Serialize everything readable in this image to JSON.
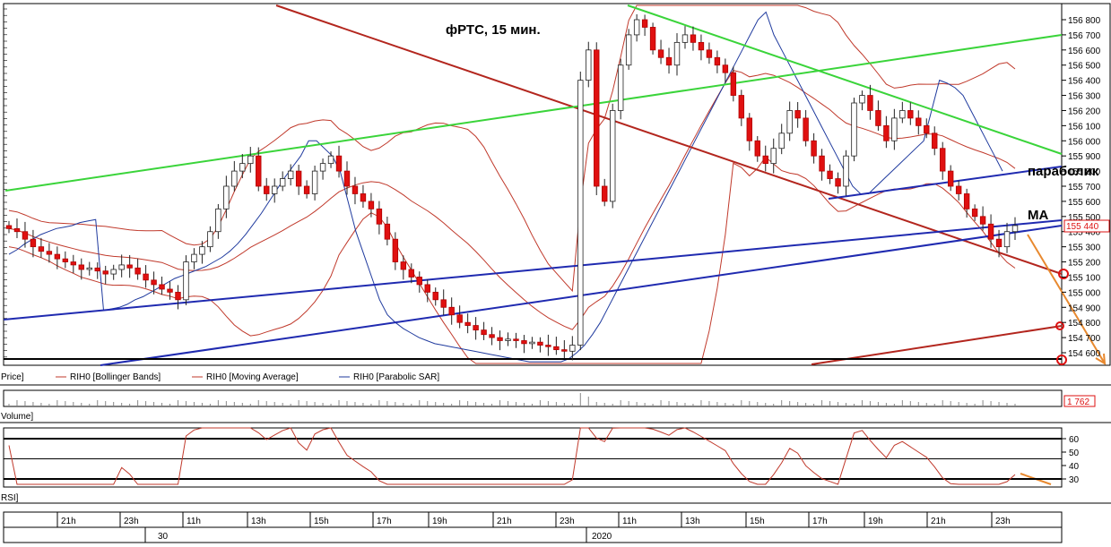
{
  "chart_data": {
    "type": "candlestick",
    "title": "фРТС,  15 мин.",
    "annotations": {
      "parabolic": "параболик",
      "ma": "MA"
    },
    "price_axis": {
      "ylim": [
        154500,
        156850
      ],
      "ticks": [
        "156 800",
        "156 700",
        "156 600",
        "156 500",
        "156 400",
        "156 300",
        "156 200",
        "156 100",
        "156 000",
        "155 900",
        "155 800",
        "155 700",
        "155 600",
        "155 500",
        "155 400",
        "155 300",
        "155 200",
        "155 100",
        "155 000",
        "154 900",
        "154 800",
        "154 700",
        "154 600"
      ],
      "tick_values": [
        156800,
        156700,
        156600,
        156500,
        156400,
        156300,
        156200,
        156100,
        156000,
        155900,
        155800,
        155700,
        155600,
        155500,
        155400,
        155300,
        155200,
        155100,
        155000,
        154900,
        154800,
        154700,
        154600
      ],
      "last_price_label": "155 440",
      "last_price": 155440
    },
    "legend": [
      "Price]",
      "RIH0 [Bollinger Bands]",
      "RIH0 [Moving Average]",
      "RIH0 [Parabolic SAR]"
    ],
    "volume": {
      "label": "Volume]",
      "last_value_label": "1 762"
    },
    "rsi": {
      "label": "RSI]",
      "ticks": [
        "60",
        "50",
        "40",
        "30"
      ],
      "tick_values": [
        60,
        50,
        40,
        30
      ],
      "levels": [
        60,
        45,
        30
      ]
    },
    "time_axis": {
      "hour_labels": [
        "21h",
        "23h",
        "11h",
        "13h",
        "15h",
        "17h",
        "19h",
        "21h",
        "23h",
        "11h",
        "13h",
        "15h",
        "17h",
        "19h",
        "21h",
        "23h"
      ],
      "day_labels": [
        "30",
        "2020"
      ]
    },
    "close_series": [
      155420,
      155400,
      155350,
      155300,
      155270,
      155250,
      155220,
      155200,
      155180,
      155150,
      155160,
      155140,
      155120,
      155150,
      155180,
      155160,
      155120,
      155080,
      155050,
      155020,
      155000,
      154950,
      155200,
      155250,
      155300,
      155400,
      155550,
      155700,
      155800,
      155850,
      155900,
      155700,
      155650,
      155700,
      155750,
      155800,
      155700,
      155650,
      155800,
      155850,
      155900,
      155800,
      155700,
      155650,
      155600,
      155550,
      155450,
      155350,
      155200,
      155150,
      155100,
      155050,
      155000,
      154950,
      154900,
      154850,
      154800,
      154780,
      154750,
      154720,
      154700,
      154680,
      154690,
      154680,
      154660,
      154670,
      154650,
      154640,
      154620,
      154610,
      154650,
      156400,
      156600,
      155700,
      155600,
      156200,
      156500,
      156700,
      156800,
      156750,
      156600,
      156550,
      156500,
      156650,
      156700,
      156650,
      156600,
      156550,
      156500,
      156450,
      156300,
      156150,
      156000,
      155900,
      155850,
      155950,
      156050,
      156200,
      156150,
      156000,
      155900,
      155800,
      155750,
      155700,
      155900,
      156250,
      156300,
      156200,
      156100,
      156000,
      156150,
      156200,
      156150,
      156100,
      156050,
      155950,
      155800,
      155700,
      155650,
      155550,
      155500,
      155450,
      155350,
      155300,
      155400,
      155440
    ],
    "parabolic_sar": [
      155250,
      155280,
      155320,
      155350,
      155380,
      155400,
      155420,
      155430,
      155440,
      155460,
      155470,
      155480,
      154880,
      154890,
      154900,
      154920,
      154950,
      154970,
      155000,
      155030,
      155060,
      155090,
      155110,
      155130,
      155150,
      155170,
      155200,
      155230,
      155270,
      155320,
      155380,
      155450,
      155520,
      155600,
      155680,
      155760,
      155830,
      155900,
      156000,
      156000,
      155950,
      155900,
      155800,
      155600,
      155400,
      155250,
      155100,
      154950,
      154850,
      154800,
      154760,
      154730,
      154700,
      154680,
      154660,
      154650,
      154640,
      154630,
      154620,
      154610,
      154600,
      154590,
      154580,
      154570,
      154560,
      154550,
      154540,
      154540,
      154540,
      154540,
      154540,
      154560,
      154600,
      154650,
      154720,
      154800,
      154900,
      155000,
      155100,
      155200,
      155300,
      155400,
      155500,
      155600,
      155700,
      155800,
      155900,
      156000,
      156100,
      156200,
      156300,
      156400,
      156500,
      156600,
      156700,
      156800,
      156850,
      156700,
      156600,
      156500,
      156400,
      156300,
      156200,
      156100,
      156000,
      155900,
      155800,
      155700,
      155650,
      155650,
      155700,
      155750,
      155800,
      155850,
      155900,
      155950,
      156000,
      156200,
      156400,
      156380,
      156350,
      156300,
      156200,
      156100,
      156000,
      155900,
      155800
    ]
  }
}
